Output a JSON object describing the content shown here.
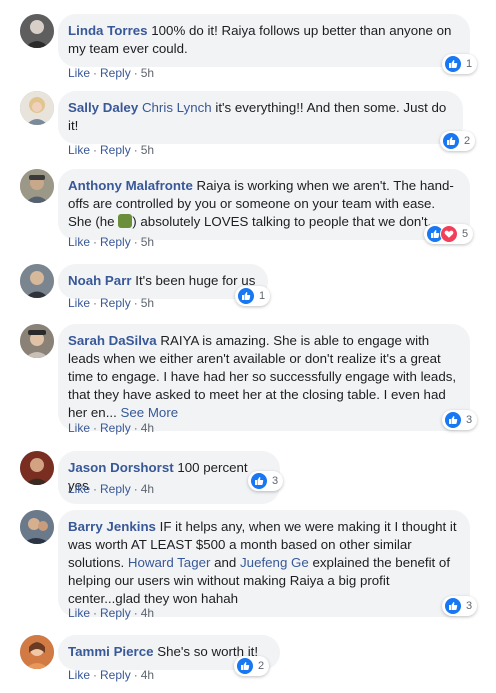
{
  "comments": [
    {
      "name": "Linda Torres",
      "text": "100% do it! Raiya follows up better than anyone on my team ever could.",
      "like_label": "Like",
      "reply_label": "Reply",
      "time": "5h",
      "reaction_count": "1",
      "avatar_color": "#6b6b6b"
    },
    {
      "name": "Sally Daley",
      "tag": "Chris Lynch",
      "text": "it's everything!! And then some. Just do it!",
      "like_label": "Like",
      "reply_label": "Reply",
      "time": "5h",
      "reaction_count": "2",
      "avatar_color": "#c9b27a"
    },
    {
      "name": "Anthony Malafronte",
      "text_before_emoji": "Raiya is working when we aren't. The hand-offs are controlled by you or someone on your team with ease. She (he",
      "text_after_emoji": ") absolutely LOVES talking to people that we don't.",
      "like_label": "Like",
      "reply_label": "Reply",
      "time": "5h",
      "reaction_count": "5",
      "avatar_color": "#8a7f6a"
    },
    {
      "name": "Noah Parr",
      "text": "It's been huge for us",
      "like_label": "Like",
      "reply_label": "Reply",
      "time": "5h",
      "reaction_count": "1",
      "avatar_color": "#5a6470"
    },
    {
      "name": "Sarah DaSilva",
      "text": "RAIYA is amazing. She is able to engage with leads when we either aren't available or don't realize it's a great time to engage. I have had her so successfully engage with leads, that they have asked to meet her at the closing table. I even had her en...",
      "see_more": "See More",
      "like_label": "Like",
      "reply_label": "Reply",
      "time": "4h",
      "reaction_count": "3",
      "avatar_color": "#7a6a5a"
    },
    {
      "name": "Jason Dorshorst",
      "text": "100 percent yes",
      "like_label": "Like",
      "reply_label": "Reply",
      "time": "4h",
      "reaction_count": "3",
      "avatar_color": "#8a3a2a"
    },
    {
      "name": "Barry Jenkins",
      "text_part1": "IF it helps any, when we were making it I thought it was worth AT LEAST $500 a month based on other similar solutions.",
      "tag1": "Howard Tager",
      "and_word": "and",
      "tag2": "Juefeng Ge",
      "text_part2": "explained the benefit of helping our users win without making Raiya a big profit center...glad they won hahah",
      "like_label": "Like",
      "reply_label": "Reply",
      "time": "4h",
      "reaction_count": "3",
      "avatar_color": "#4a5a6a"
    },
    {
      "name": "Tammi Pierce",
      "text": "She's so worth it!",
      "like_label": "Like",
      "reply_label": "Reply",
      "time": "4h",
      "reaction_count": "2",
      "avatar_color": "#c86a3a"
    }
  ],
  "colors": {
    "name_link": "#385898",
    "bubble_bg": "#f2f3f5",
    "like_blue": "#1877f2",
    "love_red": "#f33e58",
    "meta_gray": "#606770"
  },
  "icons": {
    "like": "thumbs-up-icon",
    "love": "heart-icon"
  }
}
